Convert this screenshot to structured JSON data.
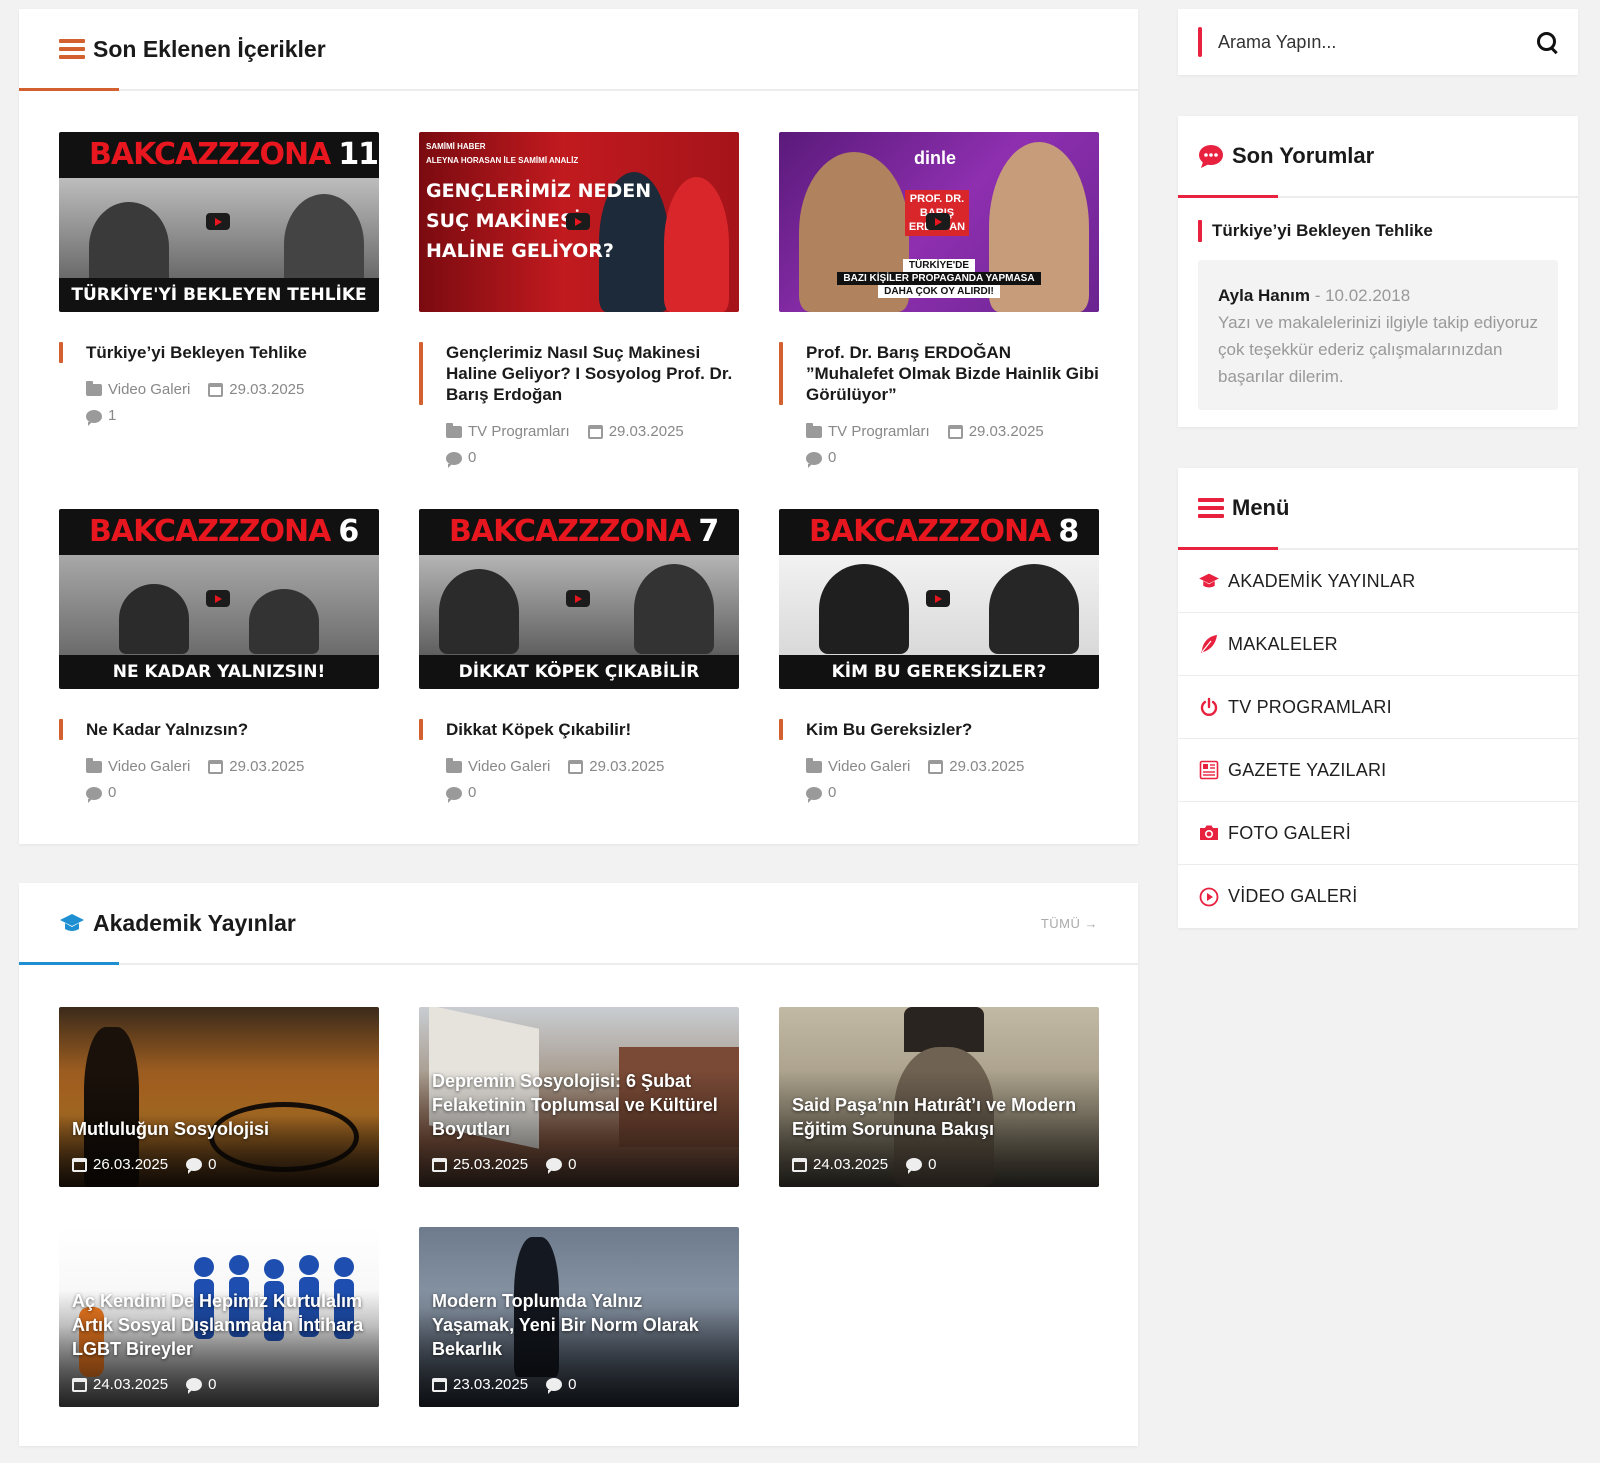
{
  "recent": {
    "title": "Son Eklenen İçerikler",
    "cards": [
      {
        "banner": "BAKCAZZZONA",
        "banner_num": "11",
        "caption": "TÜRKİYE'Yİ BEKLEYEN TEHLİKE",
        "title": "Türkiye’yi Bekleyen Tehlike",
        "category": "Video Galeri",
        "date": "29.03.2025",
        "comments": "1"
      },
      {
        "banner_lines": [
          "GENÇLERİMİZ NEDEN",
          "SUÇ MAKİNESİ",
          "HALİNE GELİYOR?"
        ],
        "banner_top": "SAMİMİ HABER",
        "banner_sub": "ALEYNA HORASAN İLE SAMİMİ ANALİZ",
        "title": "Gençlerimiz Nasıl Suç Makinesi Haline Geliyor? I Sosyolog Prof. Dr. Barış Erdoğan",
        "category": "TV Programları",
        "date": "29.03.2025",
        "comments": "0"
      },
      {
        "logo": "dinle",
        "label_lines": [
          "PROF. DR.",
          "BARIŞ",
          "ERDOĞAN"
        ],
        "caption_lines": [
          "TÜRKİYE'DE",
          "BAZI KİŞİLER PROPAGANDA YAPMASA",
          "DAHA ÇOK OY ALIRDI!"
        ],
        "title": "Prof. Dr. Barış ERDOĞAN ”Muhalefet Olmak Bizde Hainlik Gibi Görülüyor”",
        "category": "TV Programları",
        "date": "29.03.2025",
        "comments": "0"
      },
      {
        "banner": "BAKCAZZZONA",
        "banner_num": "6",
        "caption": "NE KADAR YALNIZSIN!",
        "title": "Ne Kadar Yalnızsın?",
        "category": "Video Galeri",
        "date": "29.03.2025",
        "comments": "0"
      },
      {
        "banner": "BAKCAZZZONA",
        "banner_num": "7",
        "caption": "DİKKAT KÖPEK ÇIKABİLİR",
        "title": "Dikkat Köpek Çıkabilir!",
        "category": "Video Galeri",
        "date": "29.03.2025",
        "comments": "0"
      },
      {
        "banner": "BAKCAZZZONA",
        "banner_num": "8",
        "caption": "KİM BU GEREKSİZLER?",
        "title": "Kim Bu Gereksizler?",
        "category": "Video Galeri",
        "date": "29.03.2025",
        "comments": "0"
      }
    ]
  },
  "academic": {
    "title": "Akademik Yayınlar",
    "more": "TÜMÜ →",
    "cards": [
      {
        "title": "Mutluluğun Sosyolojisi",
        "date": "26.03.2025",
        "comments": "0"
      },
      {
        "title": "Depremin Sosyolojisi: 6 Şubat Felaketinin Toplumsal ve Kültürel Boyutları",
        "date": "25.03.2025",
        "comments": "0"
      },
      {
        "title": "Said Paşa’nın Hatırât’ı ve Modern Eğitim Sorununa Bakışı",
        "date": "24.03.2025",
        "comments": "0"
      },
      {
        "title": "Aç Kendini De Hepimiz Kurtulalım Artık Sosyal Dışlanmadan İntihara LGBT Bireyler",
        "date": "24.03.2025",
        "comments": "0"
      },
      {
        "title": "Modern Toplumda Yalnız Yaşamak, Yeni Bir Norm Olarak Bekarlık",
        "date": "23.03.2025",
        "comments": "0"
      }
    ]
  },
  "search": {
    "placeholder": "Arama Yapın..."
  },
  "comments_widget": {
    "title": "Son Yorumlar",
    "post": "Türkiye’yi Bekleyen Tehlike",
    "author": "Ayla Hanım",
    "separator": " - ",
    "date": "10.02.2018",
    "text": "Yazı ve makalelerinizi ilgiyle takip ediyoruz çok teşekkür ederiz çalışmalarınızdan başarılar dilerim."
  },
  "menu": {
    "title": "Menü",
    "items": [
      {
        "label": "AKADEMİK YAYINLAR",
        "icon": "graduation-cap-icon"
      },
      {
        "label": "MAKALELER",
        "icon": "feather-icon"
      },
      {
        "label": "TV PROGRAMLARI",
        "icon": "power-icon"
      },
      {
        "label": "GAZETE YAZILARI",
        "icon": "newspaper-icon"
      },
      {
        "label": "FOTO GALERİ",
        "icon": "camera-icon"
      },
      {
        "label": "VİDEO GALERİ",
        "icon": "play-circle-icon"
      }
    ]
  },
  "colors": {
    "orange": "#d2612f",
    "red": "#e8213f",
    "blue": "#1e8fd1"
  }
}
